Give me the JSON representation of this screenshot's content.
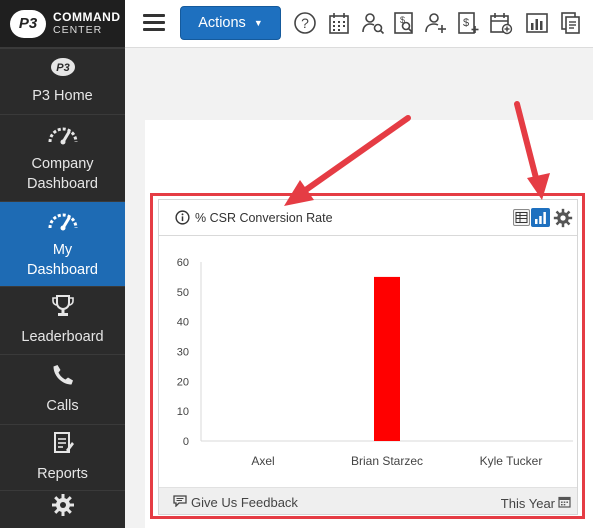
{
  "app": {
    "logo_mark": "P3",
    "logo_line1": "COMMAND",
    "logo_line2": "CENTER"
  },
  "sidebar": {
    "items": [
      {
        "label": "P3 Home",
        "icon": "p3-home-icon",
        "active": false
      },
      {
        "label": "Company Dashboard",
        "icon": "speedometer-icon",
        "active": false
      },
      {
        "label": "My Dashboard",
        "icon": "speedometer-icon",
        "active": true
      },
      {
        "label": "Leaderboard",
        "icon": "trophy-icon",
        "active": false
      },
      {
        "label": "Calls",
        "icon": "phone-icon",
        "active": false
      },
      {
        "label": "Reports",
        "icon": "report-icon",
        "active": false
      },
      {
        "label": "",
        "icon": "gear-icon",
        "active": false
      }
    ]
  },
  "topbar": {
    "actions_label": "Actions",
    "icons": [
      "help-icon",
      "calendar-grid-icon",
      "user-search-icon",
      "dollar-search-icon",
      "add-user-icon",
      "add-invoice-icon",
      "add-calendar-icon",
      "bar-chart-icon",
      "documents-icon"
    ]
  },
  "widget": {
    "title": "% CSR Conversion Rate",
    "feedback_label": "Give Us Feedback",
    "period_label": "This Year"
  },
  "colors": {
    "sidebar_bg": "#2b2b2b",
    "active_nav": "#1e6bb4",
    "accent": "#1e70bf",
    "bar": "#ff0000",
    "annotation": "#e53c44"
  },
  "chart_data": {
    "type": "bar",
    "categories": [
      "Axel",
      "Brian Starzec",
      "Kyle Tucker"
    ],
    "values": [
      0,
      55,
      0
    ],
    "yticks": [
      0,
      10,
      20,
      30,
      40,
      50,
      60
    ],
    "ylim": [
      0,
      60
    ],
    "title": "",
    "xlabel": "",
    "ylabel": ""
  }
}
